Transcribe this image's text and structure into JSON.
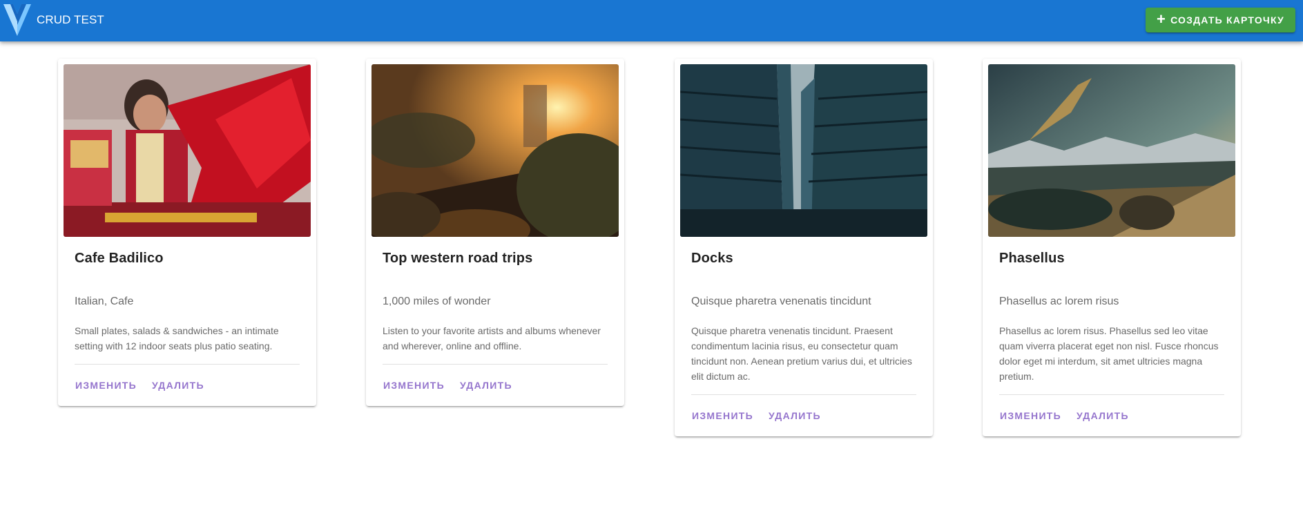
{
  "app": {
    "title": "CRUD TEST",
    "create_button_label": "СОЗДАТЬ КАРТОЧКУ",
    "colors": {
      "toolbar": "#1976D2",
      "create_button": "#43A047",
      "action_text": "#9575CD"
    }
  },
  "cards": [
    {
      "title": "Cafe Badilico",
      "subtitle": "Italian, Cafe",
      "text": "Small plates, salads & sandwiches - an intimate setting with 12 indoor seats plus patio seating.",
      "edit_label": "ИЗМЕНИТЬ",
      "delete_label": "УДАЛИТЬ"
    },
    {
      "title": "Top western road trips",
      "subtitle": "1,000 miles of wonder",
      "text": "Listen to your favorite artists and albums whenever and wherever, online and offline.",
      "edit_label": "ИЗМЕНИТЬ",
      "delete_label": "УДАЛИТЬ"
    },
    {
      "title": "Docks",
      "subtitle": "Quisque pharetra venenatis tincidunt",
      "text": "Quisque pharetra venenatis tincidunt. Praesent condimentum lacinia risus, eu consectetur quam tincidunt non. Aenean pretium varius dui, et ultricies elit dictum ac.",
      "edit_label": "ИЗМЕНИТЬ",
      "delete_label": "УДАЛИТЬ"
    },
    {
      "title": "Phasellus",
      "subtitle": "Phasellus ac lorem risus",
      "text": "Phasellus ac lorem risus. Phasellus sed leo vitae quam viverra placerat eget non nisl. Fusce rhoncus dolor eget mi interdum, sit amet ultricies magna pretium.",
      "edit_label": "ИЗМЕНИТЬ",
      "delete_label": "УДАЛИТЬ"
    }
  ]
}
